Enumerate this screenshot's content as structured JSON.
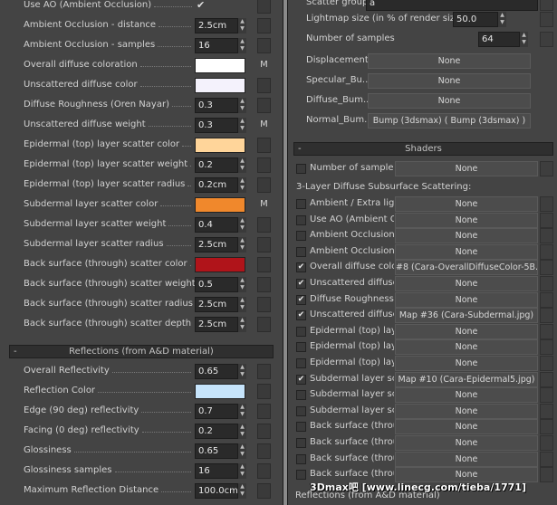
{
  "left_panel": {
    "rows": [
      {
        "label": "Use AO (Ambient Occlusion)",
        "control": "check",
        "checked": true,
        "check_glyph": "✔"
      },
      {
        "label": "Ambient Occlusion - distance",
        "control": "number",
        "value": "2.5cm"
      },
      {
        "label": "Ambient Occlusion - samples",
        "control": "number",
        "value": "16"
      },
      {
        "label": "Overall diffuse coloration",
        "control": "color",
        "color": "#ffffff",
        "map_label": "M"
      },
      {
        "label": "Unscattered diffuse color",
        "control": "color",
        "color": "#f4f2fc"
      },
      {
        "label": "Diffuse Roughness (Oren Nayar)",
        "control": "number",
        "value": "0.3"
      },
      {
        "label": "Unscattered diffuse weight",
        "control": "number",
        "value": "0.3",
        "map_label": "M"
      },
      {
        "label": "Epidermal (top) layer scatter color",
        "control": "color",
        "color": "#ffd59a"
      },
      {
        "label": "Epidermal (top) layer scatter weight",
        "control": "number",
        "value": "0.2"
      },
      {
        "label": "Epidermal (top) layer scatter radius",
        "control": "number",
        "value": "0.2cm"
      },
      {
        "label": "Subdermal layer scatter color",
        "control": "color",
        "color": "#f0882c",
        "map_label": "M"
      },
      {
        "label": "Subdermal layer scatter weight",
        "control": "number",
        "value": "0.4"
      },
      {
        "label": "Subdermal layer scatter radius",
        "control": "number",
        "value": "2.5cm"
      },
      {
        "label": "Back surface (through) scatter color",
        "control": "color",
        "color": "#b0141a"
      },
      {
        "label": "Back surface (through) scatter weight",
        "control": "number",
        "value": "0.5"
      },
      {
        "label": "Back surface (through) scatter radius",
        "control": "number",
        "value": "2.5cm"
      },
      {
        "label": "Back surface (through) scatter depth",
        "control": "number",
        "value": "2.5cm"
      }
    ],
    "reflections_rollout": {
      "sign": "-",
      "title": "Reflections (from A&D material)"
    },
    "reflection_rows": [
      {
        "label": "Overall Reflectivity",
        "control": "number",
        "value": "0.65"
      },
      {
        "label": "Reflection Color",
        "control": "color",
        "color": "#c6e4fb"
      },
      {
        "label": "Edge (90 deg) reflectivity",
        "control": "number",
        "value": "0.7"
      },
      {
        "label": "Facing (0 deg) reflectivity",
        "control": "number",
        "value": "0.2"
      },
      {
        "label": "Glossiness",
        "control": "number",
        "value": "0.65"
      },
      {
        "label": "Glossiness samples",
        "control": "number",
        "value": "16"
      },
      {
        "label": "Maximum Reflection Distance",
        "control": "number",
        "value": "100.0cm"
      }
    ]
  },
  "right_panel": {
    "scatter_group": {
      "label": "Scatter group:",
      "value": "a"
    },
    "lightmap": {
      "label": "Lightmap size (in % of render size)",
      "value": "50.0"
    },
    "samples": {
      "label": "Number of samples",
      "value": "64"
    },
    "maps": [
      {
        "label": "Displacement",
        "value": "None"
      },
      {
        "label": "Specular_Bu...",
        "value": "None"
      },
      {
        "label": "Diffuse_Bum...",
        "value": "None"
      },
      {
        "label": "Normal_Bum...",
        "value": "Bump (3dsmax)  ( Bump (3dsmax) )"
      }
    ],
    "shaders_rollout": {
      "sign": "-",
      "title": "Shaders"
    },
    "number_of_samples_shader": {
      "label": "Number of samples",
      "value": "None",
      "checked": false
    },
    "section_title": "3-Layer Diffuse Subsurface Scattering:",
    "shader_rows": [
      {
        "label": "Ambient / Extra light",
        "checked": false,
        "value": "None"
      },
      {
        "label": "Use AO (Ambient O...",
        "checked": false,
        "value": "None"
      },
      {
        "label": "Ambient Occlusion -...",
        "checked": false,
        "value": "None"
      },
      {
        "label": "Ambient Occlusion -...",
        "checked": false,
        "value": "None"
      },
      {
        "label": "Overall diffuse color...",
        "checked": true,
        "value": "#8 (Cara-OverallDiffuseColor-5B.jpg)"
      },
      {
        "label": "Unscattered diffuse ...",
        "checked": true,
        "value": "None"
      },
      {
        "label": "Diffuse Roughness ...",
        "checked": true,
        "value": "None"
      },
      {
        "label": "Unscattered diffuse ...",
        "checked": true,
        "value": "Map #36 (Cara-Subdermal.jpg)"
      },
      {
        "label": "Epidermal (top) layer...",
        "checked": false,
        "value": "None"
      },
      {
        "label": "Epidermal (top) layer...",
        "checked": false,
        "value": "None"
      },
      {
        "label": "Epidermal (top) layer...",
        "checked": false,
        "value": "None"
      },
      {
        "label": "Subdermal layer sca...",
        "checked": true,
        "value": "Map #10 (Cara-Epidermal5.jpg)"
      },
      {
        "label": "Subdermal layer sca...",
        "checked": false,
        "value": "None"
      },
      {
        "label": "Subdermal layer sca...",
        "checked": false,
        "value": "None"
      },
      {
        "label": "Back surface (throu...",
        "checked": false,
        "value": "None"
      },
      {
        "label": "Back surface (throu...",
        "checked": false,
        "value": "None"
      },
      {
        "label": "Back surface (throu...",
        "checked": false,
        "value": "None"
      },
      {
        "label": "Back surface (throu...",
        "checked": false,
        "value": "None"
      }
    ],
    "footer_label": "Reflections (from A&D material)"
  },
  "watermark": "3Dmax吧  [www.linecg.com/tieba/1771]",
  "colors": {
    "panel": "#444444",
    "field": "#2a2a2a",
    "background": "#151515"
  }
}
